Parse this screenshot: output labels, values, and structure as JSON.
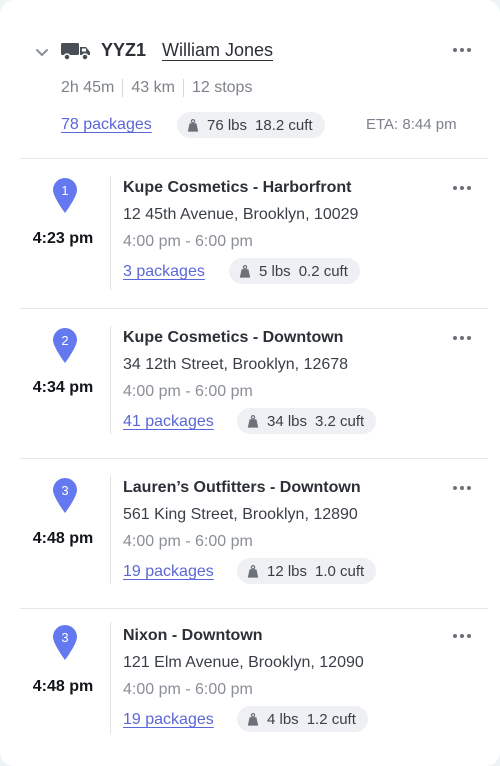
{
  "route": {
    "code": "YYZ1",
    "driver": "William Jones",
    "duration": "2h 45m",
    "distance": "43 km",
    "stops": "12 stops",
    "packages": "78 packages",
    "weight": "76 lbs",
    "volume": "18.2 cuft",
    "eta": "ETA: 8:44 pm"
  },
  "stops": [
    {
      "seq": "1",
      "time": "4:23 pm",
      "name": "Kupe Cosmetics - Harborfront",
      "address": "12 45th Avenue, Brooklyn, 10029",
      "window": "4:00 pm - 6:00 pm",
      "packages": "3 packages",
      "weight": "5 lbs",
      "volume": "0.2 cuft"
    },
    {
      "seq": "2",
      "time": "4:34 pm",
      "name": "Kupe Cosmetics - Downtown",
      "address": "34 12th Street, Brooklyn, 12678",
      "window": "4:00 pm - 6:00 pm",
      "packages": "41 packages",
      "weight": "34 lbs",
      "volume": "3.2 cuft"
    },
    {
      "seq": "3",
      "time": "4:48 pm",
      "name": "Lauren’s Outfitters - Downtown",
      "address": "561 King Street, Brooklyn, 12890",
      "window": "4:00 pm - 6:00 pm",
      "packages": "19 packages",
      "weight": "12 lbs",
      "volume": "1.0 cuft"
    },
    {
      "seq": "3",
      "time": "4:48 pm",
      "name": "Nixon - Downtown",
      "address": "121 Elm Avenue, Brooklyn, 12090",
      "window": "4:00 pm - 6:00 pm",
      "packages": "19 packages",
      "weight": "4 lbs",
      "volume": "1.2 cuft"
    }
  ],
  "colors": {
    "accent": "#5a67d8",
    "pin": "#6478f0",
    "muted": "#7d828a"
  }
}
